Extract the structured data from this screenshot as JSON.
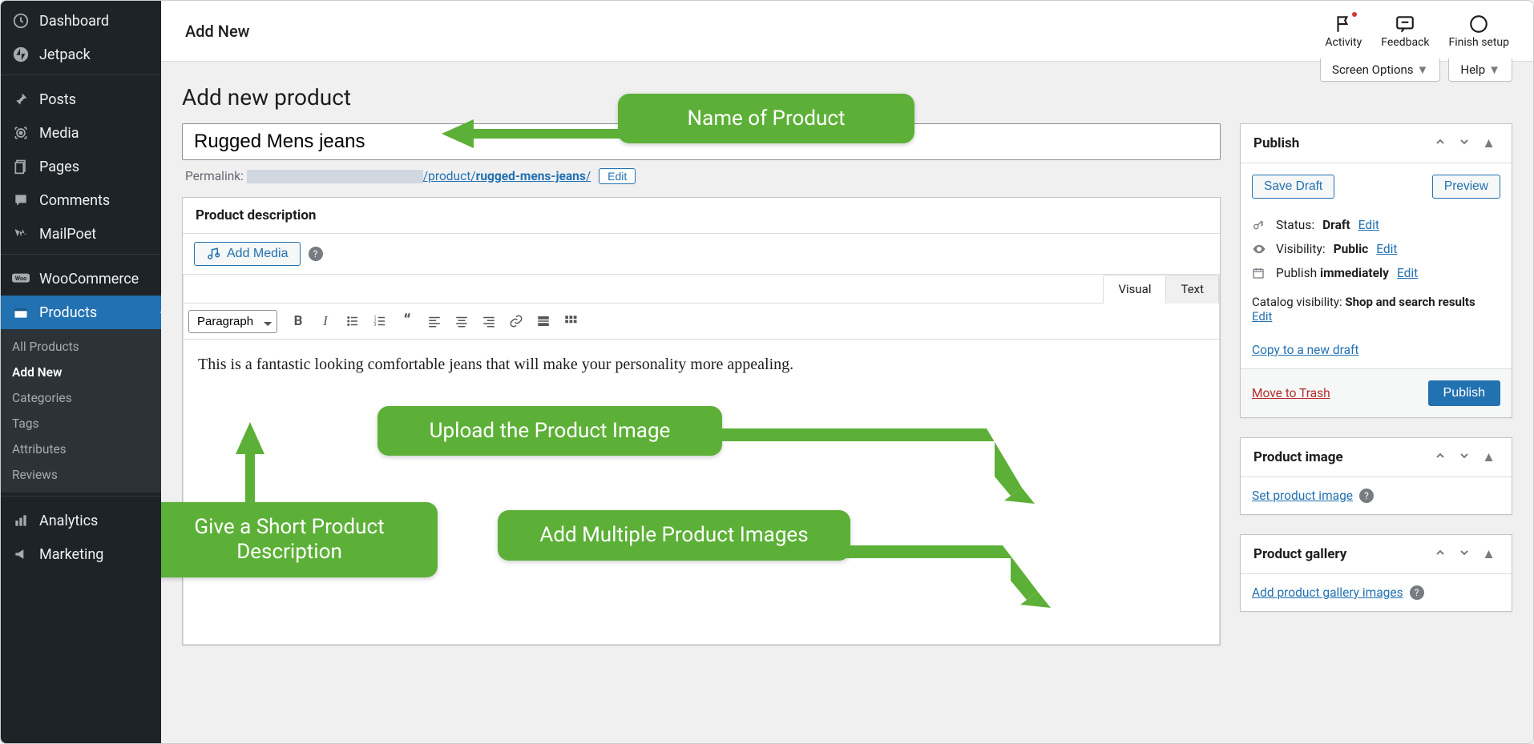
{
  "sidebar": {
    "items": [
      {
        "label": "Dashboard"
      },
      {
        "label": "Jetpack"
      },
      {
        "label": "Posts"
      },
      {
        "label": "Media"
      },
      {
        "label": "Pages"
      },
      {
        "label": "Comments"
      },
      {
        "label": "MailPoet"
      },
      {
        "label": "WooCommerce"
      },
      {
        "label": "Products",
        "active": true
      },
      {
        "label": "Analytics"
      },
      {
        "label": "Marketing"
      }
    ],
    "sub": [
      {
        "label": "All Products"
      },
      {
        "label": "Add New",
        "active": true
      },
      {
        "label": "Categories"
      },
      {
        "label": "Tags"
      },
      {
        "label": "Attributes"
      },
      {
        "label": "Reviews"
      }
    ]
  },
  "topbar": {
    "title": "Add New",
    "actions": [
      {
        "label": "Activity",
        "icon": "flag",
        "dot": true
      },
      {
        "label": "Feedback",
        "icon": "chat"
      },
      {
        "label": "Finish setup",
        "icon": "circle"
      }
    ]
  },
  "screen_options": {
    "label": "Screen Options"
  },
  "help": {
    "label": "Help"
  },
  "page_heading": "Add new product",
  "product": {
    "title": "Rugged Mens jeans",
    "permalink_label": "Permalink:",
    "permalink_path": "/product/",
    "permalink_slug": "rugged-mens-jeans",
    "permalink_tail": "/",
    "edit_label": "Edit"
  },
  "description_box": {
    "title": "Product description",
    "add_media": "Add Media",
    "visual": "Visual",
    "text": "Text",
    "paragraph": "Paragraph",
    "content": "This is a fantastic looking comfortable jeans that will make your personality more appealing."
  },
  "publish": {
    "title": "Publish",
    "save_draft": "Save Draft",
    "preview": "Preview",
    "status_label": "Status:",
    "status_value": "Draft",
    "visibility_label": "Visibility:",
    "visibility_value": "Public",
    "schedule_label": "Publish",
    "schedule_value": "immediately",
    "catalog_label": "Catalog visibility:",
    "catalog_value": "Shop and search results",
    "edit": "Edit",
    "copy": "Copy to a new draft",
    "trash": "Move to Trash",
    "publish_btn": "Publish"
  },
  "product_image": {
    "title": "Product image",
    "link": "Set product image"
  },
  "product_gallery": {
    "title": "Product gallery",
    "link": "Add product gallery images"
  },
  "callouts": {
    "name": "Name of Product",
    "desc": "Give a Short Product Description",
    "upload": "Upload the Product Image",
    "multi": "Add Multiple Product Images"
  }
}
